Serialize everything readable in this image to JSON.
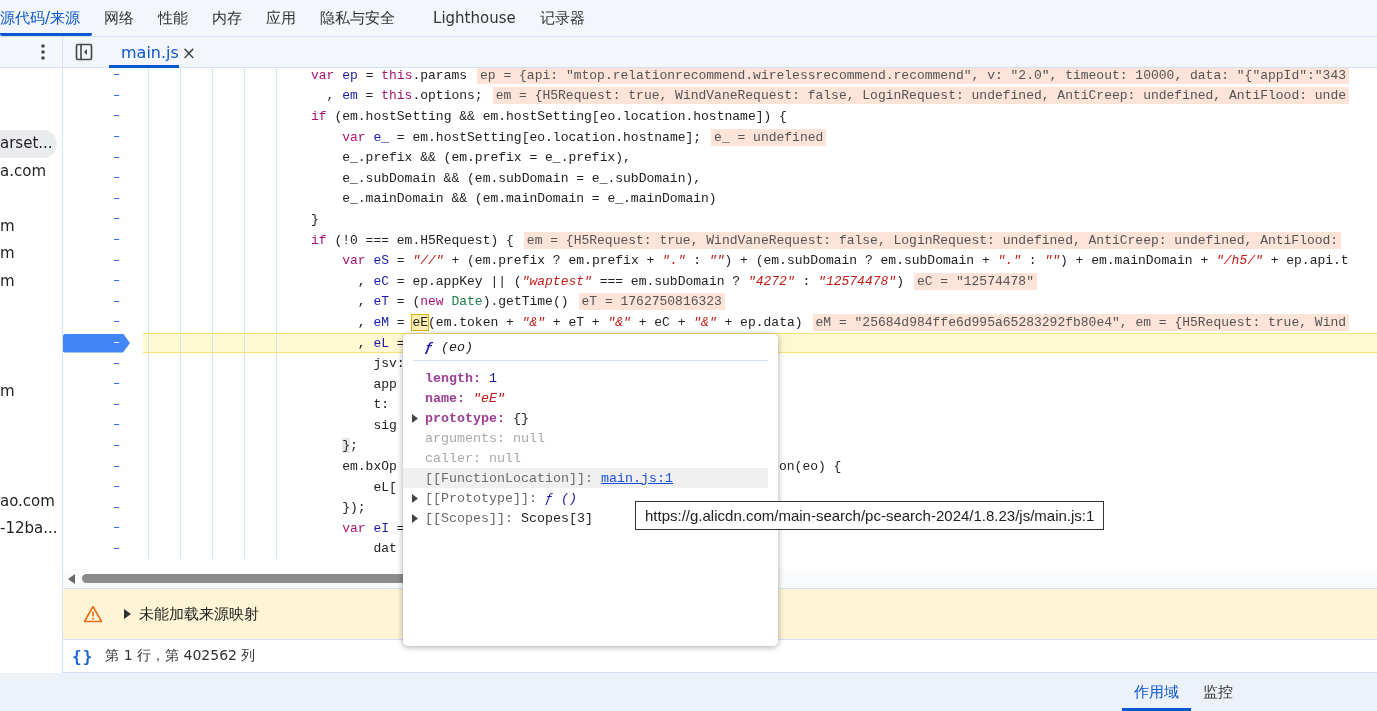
{
  "top_tabs": [
    {
      "label": "源代码/来源",
      "selected": true
    },
    {
      "label": "网络",
      "selected": false
    },
    {
      "label": "性能",
      "selected": false
    },
    {
      "label": "内存",
      "selected": false
    },
    {
      "label": "应用",
      "selected": false
    },
    {
      "label": "隐私与安全",
      "selected": false
    },
    {
      "label": "Lighthouse",
      "selected": false
    },
    {
      "label": "记录器",
      "selected": false
    }
  ],
  "sidebar": {
    "items": [
      {
        "kind": "file",
        "text": "arset...",
        "selected": true
      },
      {
        "kind": "file",
        "text": "a.com",
        "selected": false
      },
      {
        "kind": "hidden"
      },
      {
        "kind": "file",
        "text": "m",
        "selected": false
      },
      {
        "kind": "file",
        "text": "m",
        "selected": false
      },
      {
        "kind": "file",
        "text": "m",
        "selected": false
      },
      {
        "kind": "hidden"
      },
      {
        "kind": "hidden"
      },
      {
        "kind": "hidden"
      },
      {
        "kind": "file",
        "text": "m",
        "selected": false
      },
      {
        "kind": "hidden"
      },
      {
        "kind": "hidden"
      },
      {
        "kind": "hidden"
      },
      {
        "kind": "file",
        "text": "ao.com",
        "selected": false
      },
      {
        "kind": "file",
        "text": "-12ba...",
        "selected": false
      }
    ]
  },
  "editor_tabs": [
    {
      "label": "main.js",
      "close": "×",
      "selected": true
    }
  ],
  "code": {
    "lines": [
      {
        "gutter": "–",
        "current": false,
        "code": [
          {
            "kind": "keyword",
            "text": "var "
          },
          {
            "kind": "def",
            "text": "ep"
          },
          {
            "kind": "plain",
            "text": " = "
          },
          {
            "kind": "keyword",
            "text": "this"
          },
          {
            "kind": "plain",
            "text": ".params"
          }
        ],
        "eval": "ep = {api: \"mtop.relationrecommend.wirelessrecommend.recommend\", v: \"2.0\", timeout: 10000, data: \"{\"appId\":\"343"
      },
      {
        "gutter": "–",
        "current": false,
        "code": [
          {
            "kind": "plain",
            "text": "  , "
          },
          {
            "kind": "def",
            "text": "em"
          },
          {
            "kind": "plain",
            "text": " = "
          },
          {
            "kind": "keyword",
            "text": "this"
          },
          {
            "kind": "plain",
            "text": ".options;"
          }
        ],
        "eval": "em = {H5Request: true, WindVaneRequest: false, LoginRequest: undefined, AntiCreep: undefined, AntiFlood: unde"
      },
      {
        "gutter": "–",
        "current": false,
        "code": [
          {
            "kind": "keyword",
            "text": "if"
          },
          {
            "kind": "plain",
            "text": " (em.hostSetting && em.hostSetting[eo.location.hostname]) {"
          }
        ]
      },
      {
        "gutter": "–",
        "current": false,
        "code": [
          {
            "kind": "keyword",
            "text": "    var "
          },
          {
            "kind": "def",
            "text": "e_"
          },
          {
            "kind": "plain",
            "text": " = em.hostSetting[eo.location.hostname];"
          }
        ],
        "eval": "e_ = undefined"
      },
      {
        "gutter": "–",
        "current": false,
        "code": [
          {
            "kind": "plain",
            "text": "    e_.prefix && (em.prefix = e_.prefix),"
          }
        ]
      },
      {
        "gutter": "–",
        "current": false,
        "code": [
          {
            "kind": "plain",
            "text": "    e_.subDomain && (em.subDomain = e_.subDomain),"
          }
        ]
      },
      {
        "gutter": "–",
        "current": false,
        "code": [
          {
            "kind": "plain",
            "text": "    e_.mainDomain && (em.mainDomain = e_.mainDomain)"
          }
        ]
      },
      {
        "gutter": "–",
        "current": false,
        "code": [
          {
            "kind": "plain",
            "text": "}"
          }
        ]
      },
      {
        "gutter": "–",
        "current": false,
        "code": [
          {
            "kind": "keyword",
            "text": "if"
          },
          {
            "kind": "plain",
            "text": " (!0 === em.H5Request) {"
          }
        ],
        "eval": "em = {H5Request: true, WindVaneRequest: false, LoginRequest: undefined, AntiCreep: undefined, AntiFlood:"
      },
      {
        "gutter": "–",
        "current": false,
        "code": [
          {
            "kind": "keyword",
            "text": "    var "
          },
          {
            "kind": "def",
            "text": "eS"
          },
          {
            "kind": "plain",
            "text": " = "
          },
          {
            "kind": "string",
            "text": "\"//\""
          },
          {
            "kind": "plain",
            "text": " + (em.prefix ? em.prefix + "
          },
          {
            "kind": "string",
            "text": "\".\""
          },
          {
            "kind": "plain",
            "text": " : "
          },
          {
            "kind": "string",
            "text": "\"\""
          },
          {
            "kind": "plain",
            "text": ") + (em.subDomain ? em.subDomain + "
          },
          {
            "kind": "string",
            "text": "\".\""
          },
          {
            "kind": "plain",
            "text": " : "
          },
          {
            "kind": "string",
            "text": "\"\""
          },
          {
            "kind": "plain",
            "text": ") + em.mainDomain + "
          },
          {
            "kind": "string",
            "text": "\"/h5/\""
          },
          {
            "kind": "plain",
            "text": " + ep.api.t"
          }
        ]
      },
      {
        "gutter": "–",
        "current": false,
        "code": [
          {
            "kind": "plain",
            "text": "      , "
          },
          {
            "kind": "def",
            "text": "eC"
          },
          {
            "kind": "plain",
            "text": " = ep.appKey || ("
          },
          {
            "kind": "string",
            "text": "\"waptest\""
          },
          {
            "kind": "plain",
            "text": " === em.subDomain ? "
          },
          {
            "kind": "string",
            "text": "\"4272\""
          },
          {
            "kind": "plain",
            "text": " : "
          },
          {
            "kind": "string",
            "text": "\"12574478\""
          },
          {
            "kind": "plain",
            "text": ")"
          }
        ],
        "eval": "eC = \"12574478\""
      },
      {
        "gutter": "–",
        "current": false,
        "code": [
          {
            "kind": "plain",
            "text": "      , "
          },
          {
            "kind": "def",
            "text": "eT"
          },
          {
            "kind": "plain",
            "text": " = ("
          },
          {
            "kind": "keyword",
            "text": "new "
          },
          {
            "kind": "type",
            "text": "Date"
          },
          {
            "kind": "plain",
            "text": ").getTime()"
          }
        ],
        "eval": "eT = 1762750816323"
      },
      {
        "gutter": "–",
        "current": false,
        "code": [
          {
            "kind": "plain",
            "text": "      , "
          },
          {
            "kind": "def",
            "text": "eM"
          },
          {
            "kind": "plain",
            "text": " = "
          },
          {
            "kind": "hover",
            "text": "eE"
          },
          {
            "kind": "plain",
            "text": "(em.token + "
          },
          {
            "kind": "string",
            "text": "\"&\""
          },
          {
            "kind": "plain",
            "text": " + eT + "
          },
          {
            "kind": "string",
            "text": "\"&\""
          },
          {
            "kind": "plain",
            "text": " + eC + "
          },
          {
            "kind": "string",
            "text": "\"&\""
          },
          {
            "kind": "plain",
            "text": " + ep.data)"
          }
        ],
        "eval": "eM = \"25684d984ffe6d995a65283292fb80e4\", em = {H5Request: true, Wind"
      },
      {
        "gutter": "–",
        "current": true,
        "code": [
          {
            "kind": "plain",
            "text": "      , "
          },
          {
            "kind": "def",
            "text": "eL"
          },
          {
            "kind": "plain",
            "text": " ="
          }
        ]
      },
      {
        "gutter": "–",
        "current": false,
        "code": [
          {
            "kind": "plain",
            "text": "        jsv:"
          }
        ]
      },
      {
        "gutter": "–",
        "current": false,
        "code": [
          {
            "kind": "plain",
            "text": "        app"
          }
        ]
      },
      {
        "gutter": "–",
        "current": false,
        "code": [
          {
            "kind": "plain",
            "text": "        t:"
          }
        ]
      },
      {
        "gutter": "–",
        "current": false,
        "code": [
          {
            "kind": "plain",
            "text": "        sig"
          }
        ]
      },
      {
        "gutter": "–",
        "current": false,
        "code": [
          {
            "kind": "match",
            "text": "    }"
          },
          {
            "kind": "plain",
            "text": ";"
          }
        ]
      },
      {
        "gutter": "–",
        "current": false,
        "code": [
          {
            "kind": "plain",
            "text": "    em.bxOp"
          }
        ],
        "tail": "on(eo) {"
      },
      {
        "gutter": "–",
        "current": false,
        "code": [
          {
            "kind": "plain",
            "text": "        eL["
          }
        ]
      },
      {
        "gutter": "–",
        "current": false,
        "code": [
          {
            "kind": "plain",
            "text": "    });"
          }
        ]
      },
      {
        "gutter": "–",
        "current": false,
        "code": [
          {
            "kind": "keyword",
            "text": "    var "
          },
          {
            "kind": "def",
            "text": "eI"
          },
          {
            "kind": "plain",
            "text": " ="
          }
        ]
      },
      {
        "gutter": "–",
        "current": false,
        "code": [
          {
            "kind": "plain",
            "text": "        dat"
          }
        ]
      }
    ]
  },
  "warning": {
    "text": "未能加载来源映射"
  },
  "status_bar": {
    "format_icon": "{}",
    "position": "第 1 行，第 402562 列"
  },
  "popup": {
    "symbol": "ƒ",
    "params": "(eo)",
    "properties": [
      {
        "key": "length:",
        "value": "1",
        "kind": "number",
        "own": true,
        "dimmed": false,
        "expandable": false,
        "highlighted": false
      },
      {
        "key": "name:",
        "value": "\"eE\"",
        "kind": "string",
        "own": true,
        "dimmed": false,
        "expandable": false,
        "highlighted": false
      },
      {
        "key": "prototype:",
        "value": "{}",
        "kind": "plain",
        "own": true,
        "dimmed": false,
        "expandable": true,
        "highlighted": false
      },
      {
        "key": "arguments:",
        "value": "null",
        "kind": "null",
        "own": false,
        "dimmed": true,
        "expandable": false,
        "highlighted": false
      },
      {
        "key": "caller:",
        "value": "null",
        "kind": "null",
        "own": false,
        "dimmed": true,
        "expandable": false,
        "highlighted": false
      },
      {
        "key": "[[FunctionLocation]]:",
        "value": "main.js:1",
        "kind": "link",
        "own": false,
        "dimmed": false,
        "expandable": false,
        "highlighted": true
      },
      {
        "key": "[[Prototype]]:",
        "value": "ƒ ()",
        "kind": "function",
        "own": false,
        "dimmed": false,
        "expandable": true,
        "highlighted": false
      },
      {
        "key": "[[Scopes]]:",
        "value": "Scopes[3]",
        "kind": "plain",
        "own": false,
        "dimmed": false,
        "expandable": true,
        "highlighted": false
      }
    ]
  },
  "tooltip": {
    "text": "https://g.alicdn.com/main-search/pc-search-2024/1.8.23/js/main.js:1"
  },
  "bottom_tabs": [
    {
      "label": "作用域",
      "selected": true
    },
    {
      "label": "监控",
      "selected": false
    }
  ]
}
